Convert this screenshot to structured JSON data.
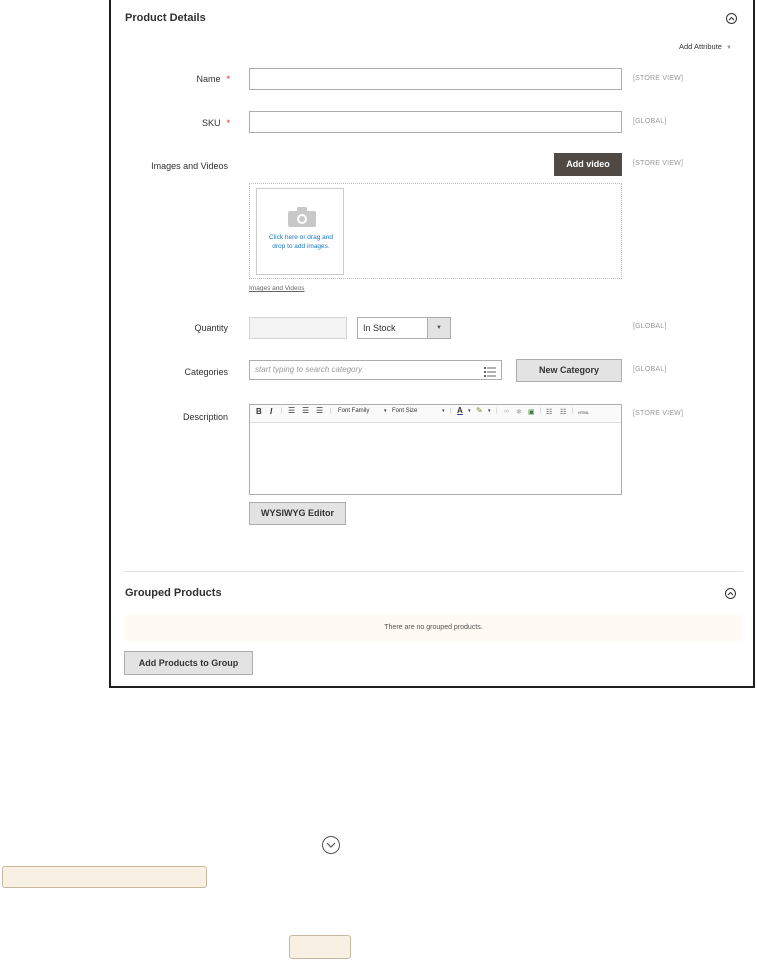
{
  "product_details": {
    "title": "Product Details",
    "add_attribute": "Add Attribute",
    "name": {
      "label": "Name",
      "value": "",
      "scope": "[STORE VIEW]"
    },
    "sku": {
      "label": "SKU",
      "value": "",
      "scope": "[GLOBAL]"
    },
    "images": {
      "label": "Images and Videos",
      "add_video": "Add video",
      "scope": "[STORE VIEW]",
      "dropzone_text": "Click here or drag and drop to add images.",
      "link": "Images and Videos"
    },
    "quantity": {
      "label": "Quantity",
      "value": "",
      "stock_status": "In Stock",
      "scope": "[GLOBAL]"
    },
    "categories": {
      "label": "Categories",
      "placeholder": "start typing to search category",
      "new_category": "New Category",
      "scope": "[GLOBAL]"
    },
    "description": {
      "label": "Description",
      "scope": "[STORE VIEW]",
      "toolbar": {
        "bold": "B",
        "italic": "I",
        "font_family": "Font Family",
        "font_size": "Font Size",
        "html": "HTML"
      },
      "wysiwyg_button": "WYSIWYG Editor"
    }
  },
  "grouped_products": {
    "title": "Grouped Products",
    "notice": "There are no grouped products.",
    "add_button": "Add Products to Group"
  }
}
